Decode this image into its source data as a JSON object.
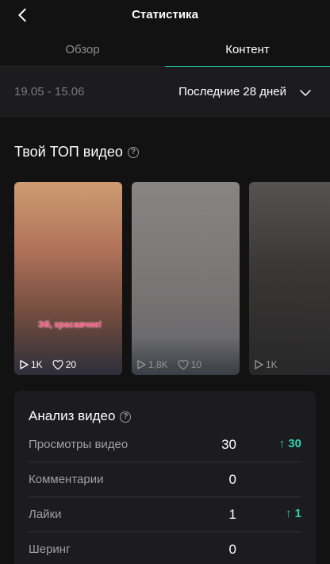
{
  "header": {
    "title": "Статистика",
    "back_icon": "chevron-left-icon"
  },
  "tabs": [
    {
      "label": "Обзор",
      "active": false
    },
    {
      "label": "Контент",
      "active": true
    }
  ],
  "date_range": {
    "range": "19.05 - 15.06",
    "period_label": "Последние 28 дней"
  },
  "top_videos": {
    "title": "Твой ТОП видео",
    "items": [
      {
        "views": "1K",
        "likes": "20",
        "caption": "Эй, красавчик!"
      },
      {
        "views": "1,8K",
        "likes": "10"
      },
      {
        "views": "1K",
        "likes": ""
      }
    ]
  },
  "analysis": {
    "title": "Анализ видео",
    "rows": [
      {
        "label": "Просмотры видео",
        "value": "30",
        "delta": "↑ 30"
      },
      {
        "label": "Комментарии",
        "value": "0",
        "delta": ""
      },
      {
        "label": "Лайки",
        "value": "1",
        "delta": "↑ 1"
      },
      {
        "label": "Шеринг",
        "value": "0",
        "delta": ""
      }
    ]
  },
  "colors": {
    "accent": "#2fcfb0",
    "background": "#121212",
    "card": "#1c1c1e"
  }
}
